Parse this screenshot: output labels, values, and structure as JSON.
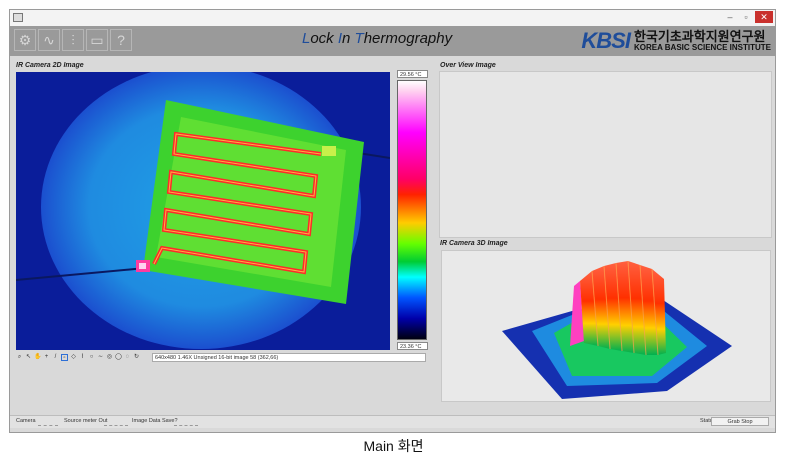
{
  "window": {
    "controls": {
      "minimize": "–",
      "maximize": "▫",
      "close": "✕"
    }
  },
  "toolbar": {
    "tools": [
      {
        "name": "settings-tool-icon",
        "glyph": "⚙"
      },
      {
        "name": "waveform-tool-icon",
        "glyph": "∿"
      },
      {
        "name": "sliders-tool-icon",
        "glyph": "⫶"
      },
      {
        "name": "monitor-tool-icon",
        "glyph": "▭"
      },
      {
        "name": "help-tool-icon",
        "glyph": "?"
      }
    ],
    "title_parts": [
      "L",
      "ock ",
      "I",
      "n ",
      "T",
      "hermography"
    ]
  },
  "logo": {
    "mark": "KBSI",
    "korean": "한국기초과학지원연구원",
    "english": "KOREA BASIC SCIENCE INSTITUTE"
  },
  "panels": {
    "ir2d_label": "IR Camera 2D Image",
    "overview_label": "Over View Image",
    "ir3d_label": "IR Camera 3D Image"
  },
  "colorbar": {
    "max": "29.56 °C",
    "min": "23.36 °C"
  },
  "image_status": "640x480 1.46X Unsigned 16-bit image 58    (362,66)",
  "bottom": {
    "camera": "Camera",
    "source_meter": "Source meter Out",
    "image_data_save": "Image Data Save?",
    "status": "Status",
    "grab_button": "Grab Stop"
  },
  "caption": "Main 화면",
  "colors": {
    "accent": "#1f4d9a",
    "toolbar": "#9a9a9a",
    "ir_background": "#0a1d9a"
  }
}
